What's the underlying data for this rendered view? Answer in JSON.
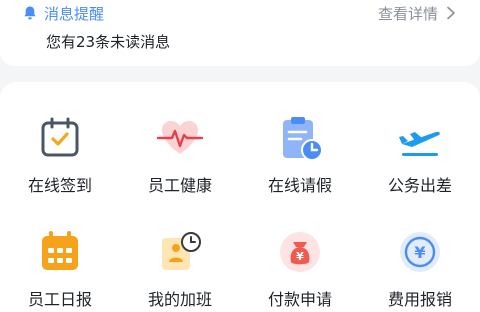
{
  "notice": {
    "title": "消息提醒",
    "details_label": "查看详情",
    "unread_text": "您有23条未读消息"
  },
  "apps": [
    {
      "label": "在线签到",
      "icon": "calendar-check-icon"
    },
    {
      "label": "员工健康",
      "icon": "heart-pulse-icon"
    },
    {
      "label": "在线请假",
      "icon": "clipboard-clock-icon"
    },
    {
      "label": "公务出差",
      "icon": "airplane-takeoff-icon"
    },
    {
      "label": "员工日报",
      "icon": "calendar-grid-icon"
    },
    {
      "label": "我的加班",
      "icon": "person-clock-icon"
    },
    {
      "label": "付款申请",
      "icon": "money-bag-icon"
    },
    {
      "label": "费用报销",
      "icon": "yen-coin-icon"
    }
  ],
  "colors": {
    "accent": "#4b8df5",
    "text": "#1f2329",
    "muted": "#8a8f99",
    "background": "#f4f5f7"
  }
}
